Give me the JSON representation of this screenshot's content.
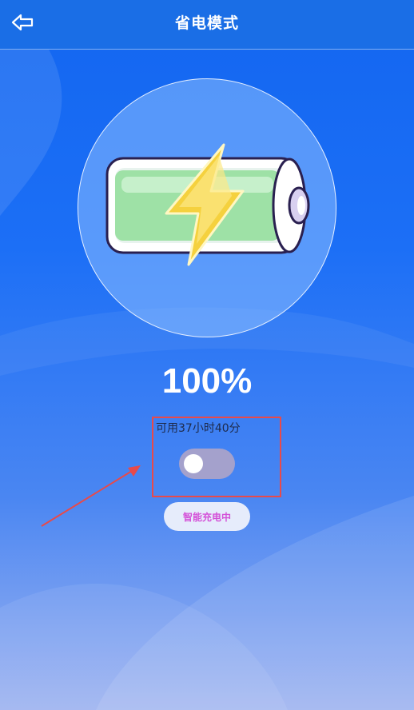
{
  "header": {
    "title": "省电模式",
    "back_icon": "back-arrow-icon"
  },
  "battery": {
    "percent_text": "100%",
    "level": 1.0,
    "remaining_text": "可用37小时40分",
    "icons": [
      "battery-icon",
      "lightning-bolt-icon"
    ]
  },
  "power_saving_toggle": {
    "state": "off"
  },
  "smart_charge": {
    "label": "智能充电中"
  },
  "colors": {
    "header_bg": "#1a6ee6",
    "highlight": "#e84a4a",
    "toggle_track": "#a4a1cc",
    "smart_charge_text": "#d452d8"
  }
}
